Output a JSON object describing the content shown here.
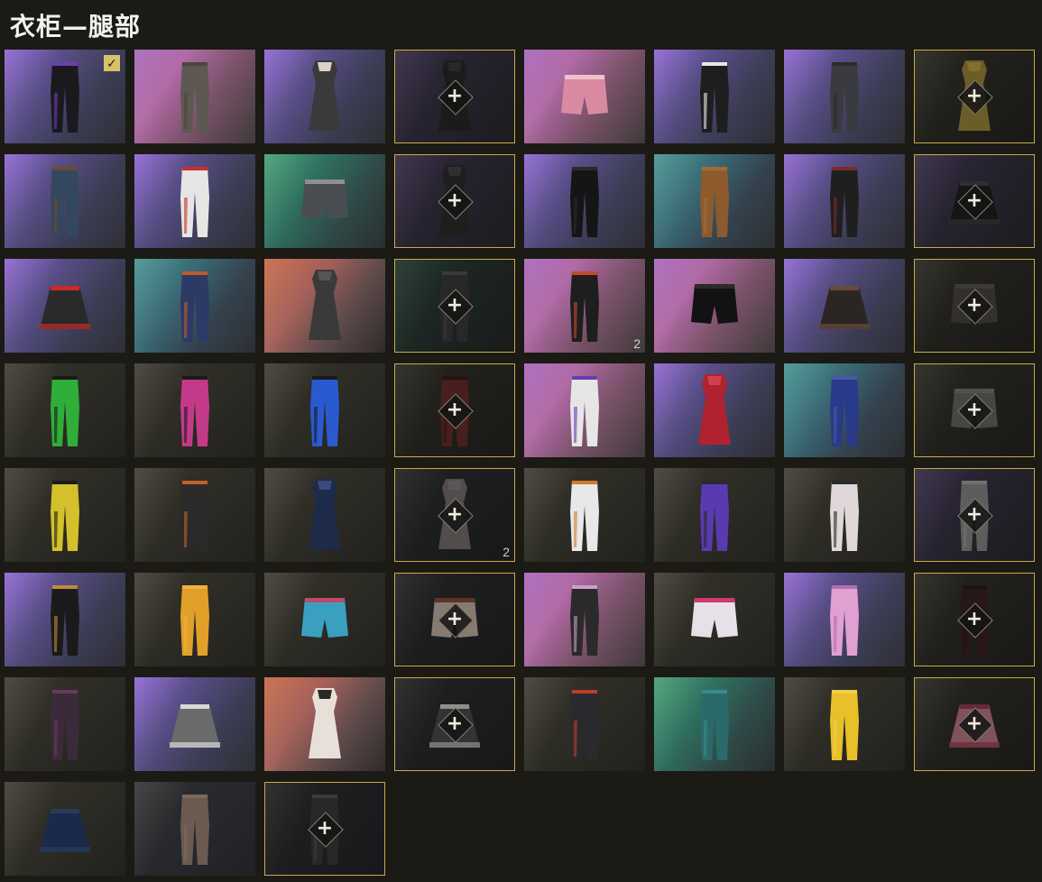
{
  "title": "衣柜—腿部",
  "check_icon": "check-icon",
  "plus_icon": "plus-icon",
  "items": [
    {
      "bg": "purple",
      "kind": "pants",
      "color": "#1a1a1e",
      "accent": "#6a3fb0",
      "selected": true
    },
    {
      "bg": "pink",
      "kind": "pants",
      "color": "#5e5852",
      "accent": "#4a4540"
    },
    {
      "bg": "purple",
      "kind": "dress",
      "color": "#3a3a3a",
      "accent": "#d8d2c8"
    },
    {
      "bg": "ppdim",
      "kind": "dress",
      "color": "#262626",
      "accent": "#3a3a3a",
      "set": true
    },
    {
      "bg": "pink",
      "kind": "shorts",
      "color": "#d98aa0",
      "accent": "#f0c0cc"
    },
    {
      "bg": "purple",
      "kind": "pants",
      "color": "#1e1e1e",
      "accent": "#e8e8e8"
    },
    {
      "bg": "purple",
      "kind": "pants",
      "color": "#3a3b40",
      "accent": "#2a2a2a"
    },
    {
      "bg": "dark",
      "kind": "dress",
      "color": "#a08a3a",
      "accent": "#c4a840",
      "set": true
    },
    {
      "bg": "purple",
      "kind": "pants",
      "color": "#33475e",
      "accent": "#6b4a30"
    },
    {
      "bg": "purple",
      "kind": "pants",
      "color": "#e8e6e4",
      "accent": "#c8302c"
    },
    {
      "bg": "green",
      "kind": "shorts",
      "color": "#4a4d52",
      "accent": "#8c8f94"
    },
    {
      "bg": "ppdim",
      "kind": "dress",
      "color": "#2a2a2a",
      "accent": "#444",
      "set": true
    },
    {
      "bg": "purple",
      "kind": "pants",
      "color": "#151515",
      "accent": "#2a2a2a"
    },
    {
      "bg": "teal",
      "kind": "pants",
      "color": "#8c5a2c",
      "accent": "#a06a3a"
    },
    {
      "bg": "purple",
      "kind": "pants",
      "color": "#1f1f1f",
      "accent": "#7a2a2a"
    },
    {
      "bg": "ppdim",
      "kind": "skirt",
      "color": "#1c1c1c",
      "accent": "#444",
      "set": true
    },
    {
      "bg": "purple",
      "kind": "skirt",
      "color": "#2a2a2a",
      "accent": "#c82a2a"
    },
    {
      "bg": "teal",
      "kind": "pants",
      "color": "#2d3a66",
      "accent": "#c05a2a"
    },
    {
      "bg": "orange",
      "kind": "dress",
      "color": "#3a3a3a",
      "accent": "#555"
    },
    {
      "bg": "grndim",
      "kind": "pants",
      "color": "#3a3a3a",
      "accent": "#555",
      "set": true
    },
    {
      "bg": "pink",
      "kind": "pants",
      "color": "#1e1e1e",
      "accent": "#c04a30"
    },
    {
      "bg": "pink",
      "kind": "shorts",
      "color": "#121212",
      "accent": "#2a2a2a"
    },
    {
      "bg": "purple",
      "kind": "skirt",
      "color": "#2b2623",
      "accent": "#6a4a3a"
    },
    {
      "bg": "dark",
      "kind": "shorts",
      "color": "#4a4540",
      "accent": "#5a5550",
      "set": true
    },
    {
      "bg": "dark",
      "kind": "pants",
      "color": "#2fae3a",
      "accent": "#1a1a1a"
    },
    {
      "bg": "dark",
      "kind": "pants",
      "color": "#c43a8a",
      "accent": "#1a1a1a"
    },
    {
      "bg": "dark",
      "kind": "pants",
      "color": "#2a5ad0",
      "accent": "#1a1a1a"
    },
    {
      "bg": "dark",
      "kind": "pants",
      "color": "#6a2a2a",
      "accent": "#3a1a1a",
      "set": true
    },
    {
      "bg": "pink",
      "kind": "pants",
      "color": "#e6e6e6",
      "accent": "#6a3ab0"
    },
    {
      "bg": "purple",
      "kind": "dress",
      "color": "#b02230",
      "accent": "#d04050"
    },
    {
      "bg": "teal",
      "kind": "pants",
      "color": "#2a3a8a",
      "accent": "#4a5aa0"
    },
    {
      "bg": "dark",
      "kind": "shorts",
      "color": "#6a6865",
      "accent": "#7a7875",
      "set": true
    },
    {
      "bg": "dark",
      "kind": "pants",
      "color": "#d4c02a",
      "accent": "#1a1a1a"
    },
    {
      "bg": "dark",
      "kind": "pants",
      "color": "#2a2a2a",
      "accent": "#c0602a"
    },
    {
      "bg": "dark",
      "kind": "dress",
      "color": "#1e2a4a",
      "accent": "#3a4a7a"
    },
    {
      "bg": "dim",
      "kind": "dress",
      "color": "#7a7070",
      "accent": "#8a8080",
      "set": true,
      "count": "2"
    },
    {
      "bg": "dark",
      "kind": "pants",
      "color": "#e8e8e8",
      "accent": "#d07a2a"
    },
    {
      "bg": "dark",
      "kind": "pants",
      "color": "#5a3ab0",
      "accent": "#2a2a2a"
    },
    {
      "bg": "dark",
      "kind": "pants",
      "color": "#e0d8d8",
      "accent": "#2a2a2a"
    },
    {
      "bg": "ppdim",
      "kind": "pants",
      "color": "#8a8a8a",
      "accent": "#aaa",
      "set": true
    },
    {
      "bg": "purple",
      "kind": "pants",
      "color": "#1a1a1a",
      "accent": "#c08a3a"
    },
    {
      "bg": "dark",
      "kind": "pants",
      "color": "#e0a02a",
      "accent": "#f0b03a"
    },
    {
      "bg": "dark",
      "kind": "shorts",
      "color": "#3aa0c0",
      "accent": "#c04a6a"
    },
    {
      "bg": "dim",
      "kind": "shorts",
      "color": "#c8b8a8",
      "accent": "#8a4a3a",
      "set": true
    },
    {
      "bg": "pink",
      "kind": "pants",
      "color": "#2a2a2a",
      "accent": "#c8a0c8"
    },
    {
      "bg": "dark",
      "kind": "shorts",
      "color": "#e8e0e8",
      "accent": "#d03a6a"
    },
    {
      "bg": "purple",
      "kind": "pants",
      "color": "#e0a0d0",
      "accent": "#b070b0"
    },
    {
      "bg": "dark",
      "kind": "pants",
      "color": "#3a2020",
      "accent": "#2a1a1a",
      "set": true
    },
    {
      "bg": "dark",
      "kind": "pants",
      "color": "#3a2a3a",
      "accent": "#6a3a5a"
    },
    {
      "bg": "purple",
      "kind": "skirt",
      "color": "#6a6a6a",
      "accent": "#d8d8d8"
    },
    {
      "bg": "orange",
      "kind": "dress",
      "color": "#e8e0d8",
      "accent": "#2a2a2a"
    },
    {
      "bg": "dim",
      "kind": "skirt",
      "color": "#4a4a4a",
      "accent": "#d8d8d8",
      "set": true
    },
    {
      "bg": "dark",
      "kind": "pants",
      "color": "#2a2a2e",
      "accent": "#c03a2a"
    },
    {
      "bg": "green",
      "kind": "pants",
      "color": "#2a6a6a",
      "accent": "#3a8a8a"
    },
    {
      "bg": "dark",
      "kind": "pants",
      "color": "#e8c02a",
      "accent": "#f0d04a"
    },
    {
      "bg": "dark",
      "kind": "skirt",
      "color": "#c07a8a",
      "accent": "#9a3a4a",
      "set": true
    },
    {
      "bg": "dark",
      "kind": "skirt",
      "color": "#1a2a4a",
      "accent": "#2a3a5a"
    },
    {
      "bg": "dim",
      "kind": "pants",
      "color": "#6a5a50",
      "accent": "#7a6a60"
    },
    {
      "bg": "dim",
      "kind": "pants",
      "color": "#3a3a3a",
      "accent": "#555",
      "set": true
    }
  ],
  "extra_count": {
    "index": 20,
    "value": "2"
  }
}
